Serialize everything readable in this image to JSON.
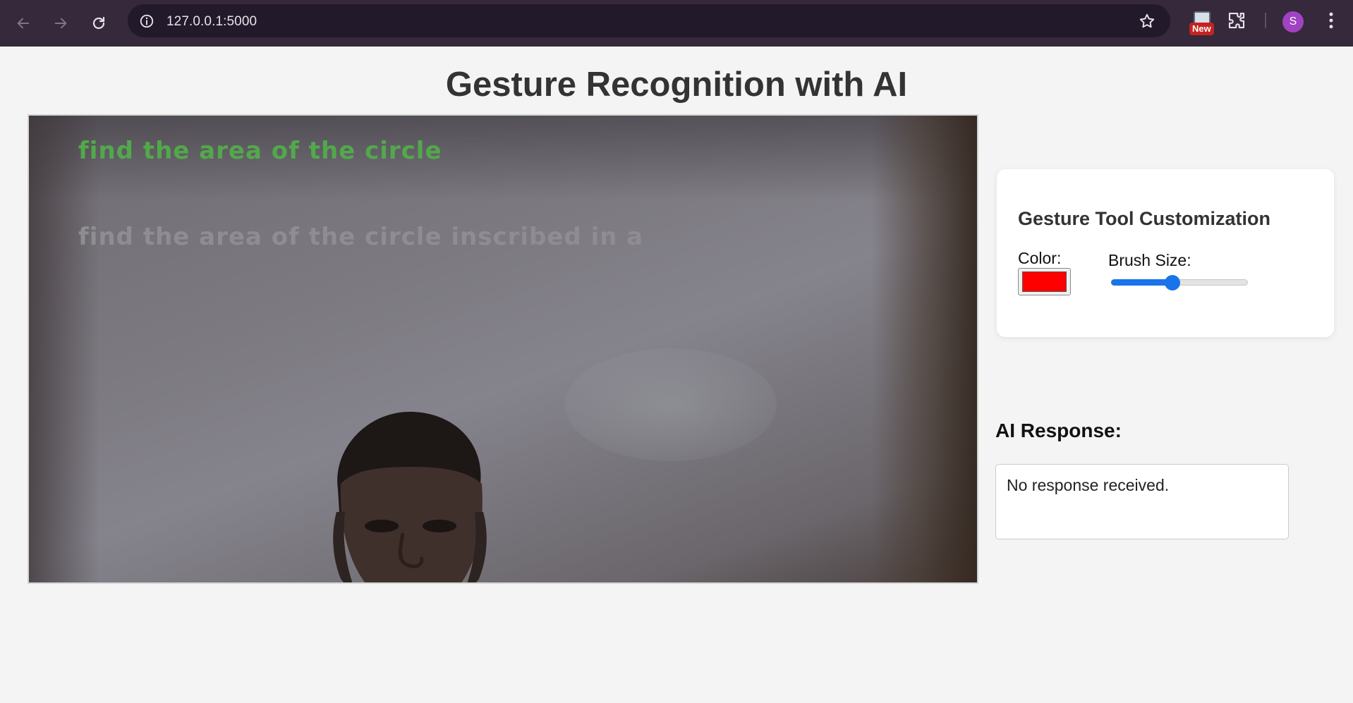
{
  "browser": {
    "url": "127.0.0.1:5000",
    "extension_badge": "New",
    "profile_initial": "S"
  },
  "page": {
    "title": "Gesture Recognition with AI"
  },
  "video": {
    "question_text": "find the area of the circle",
    "recognized_text": "find the area of the circle inscribed in a"
  },
  "tool_panel": {
    "heading": "Gesture Tool Customization",
    "color_label": "Color:",
    "color_value": "#ff0000",
    "brush_label": "Brush Size:",
    "brush_level": 0.45
  },
  "ai": {
    "heading": "AI Response:",
    "response": "No response received."
  },
  "colors": {
    "chrome_bg": "#35293b",
    "page_bg": "#f4f4f4",
    "accent": "#1a73e8",
    "overlay_green": "#52a84b"
  }
}
